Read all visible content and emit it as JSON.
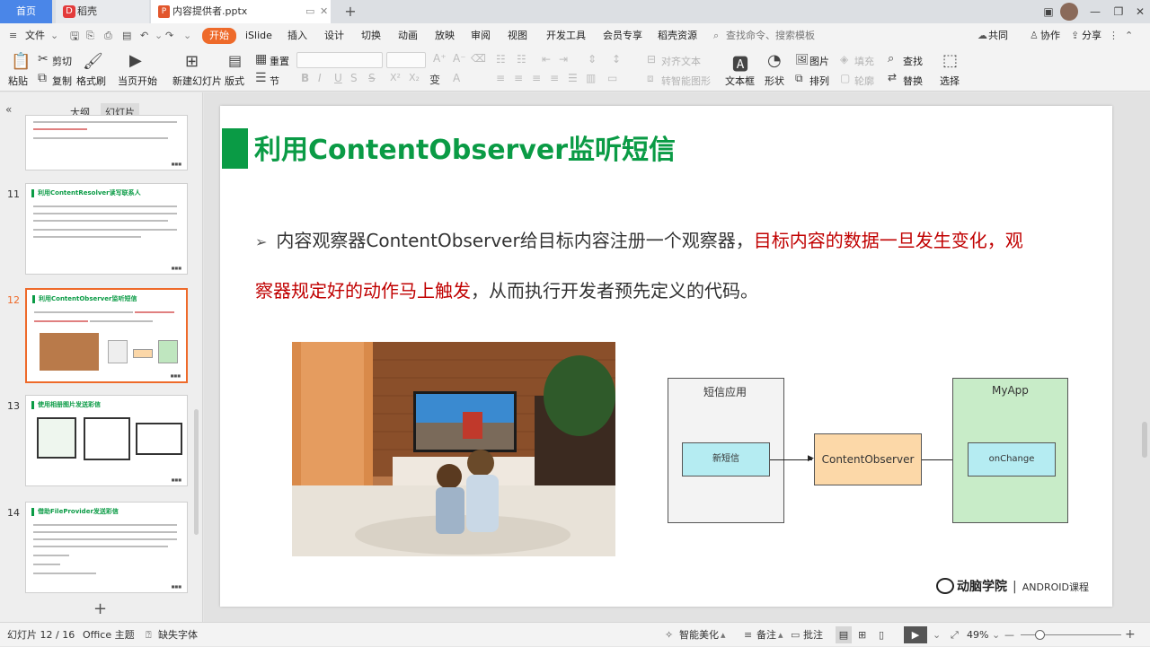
{
  "tabs": {
    "home": "首页",
    "daoke": "稻壳",
    "file": "内容提供者.pptx"
  },
  "menu": {
    "file": "文件",
    "items": [
      "开始",
      "iSlide",
      "插入",
      "设计",
      "切换",
      "动画",
      "放映",
      "审阅",
      "视图",
      "开发工具",
      "会员专享",
      "稻壳资源"
    ],
    "search_placeholder": "查找命令、搜索模板",
    "collab": "共同",
    "coop": "协作",
    "share": "分享"
  },
  "toolbar": {
    "paste": "粘贴",
    "cut": "剪切",
    "copy": "复制",
    "format_painter": "格式刷",
    "play_current": "当页开始",
    "new_slide": "新建幻灯片",
    "layout": "版式",
    "section": "节",
    "reset": "重置",
    "align_text": "对齐文本",
    "smart_shape": "转智能图形",
    "textbox": "文本框",
    "shape": "形状",
    "picture": "图片",
    "arrange": "排列",
    "fill": "填充",
    "outline": "轮廓",
    "find": "查找",
    "replace": "替换",
    "select": "选择"
  },
  "left_panel": {
    "outline_tab": "大纲",
    "slides_tab": "幻灯片",
    "thumbs": [
      {
        "num": "",
        "title": ""
      },
      {
        "num": "11",
        "title": "利用ContentResolver读写联系人"
      },
      {
        "num": "12",
        "title": "利用ContentObserver监听短信"
      },
      {
        "num": "13",
        "title": "使用相册图片发送彩信"
      },
      {
        "num": "14",
        "title": "借助FileProvider发送彩信"
      }
    ]
  },
  "slide": {
    "title": "利用ContentObserver监听短信",
    "bullet_part1": "内容观察器ContentObserver给目标内容注册一个观察器，",
    "bullet_red1": "目标内容的数据一旦发生变化，观察器规定好的动作马上触发",
    "bullet_part2": "，从而执行开发者预先定义的代码。",
    "diagram": {
      "sms_app": "短信应用",
      "new_sms": "新短信",
      "observer": "ContentObserver",
      "myapp": "MyApp",
      "on_change": "onChange"
    },
    "brand": "动脑学院",
    "course": "ANDROID课程"
  },
  "status": {
    "slide_pos": "幻灯片 12 / 16",
    "theme": "Office 主题",
    "missing_font": "缺失字体",
    "beautify": "智能美化",
    "notes": "备注",
    "comments": "批注",
    "zoom": "49%"
  },
  "colors": {
    "accent": "#ee6a2a",
    "title_green": "#0a9b45",
    "red_text": "#c00000",
    "tab_blue": "#4a86e8"
  }
}
